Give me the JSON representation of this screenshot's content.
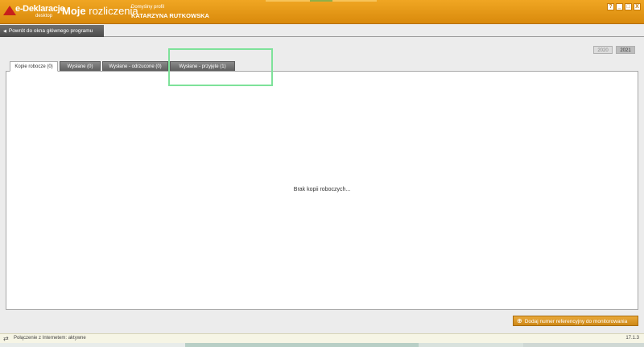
{
  "app": {
    "logo_name": "e-Deklaracje",
    "logo_sub": "desktop",
    "title_bold": "Moje",
    "title_rest": " rozliczenia",
    "profile_label": "Domyślny profil",
    "profile_name": "KATARZYNA RUTKOWSKA"
  },
  "window_buttons": [
    "?",
    "_",
    "□",
    "X"
  ],
  "back_button": {
    "label": "Powrót do okna głównego programu",
    "icon": "left-arrow-icon"
  },
  "years": [
    "2020",
    "2021"
  ],
  "tabs": [
    {
      "label": "Kopie robocze (0)",
      "active": true
    },
    {
      "label": "Wysłane (0)",
      "active": false
    },
    {
      "label": "Wysłane - odrzucone (0)",
      "active": false
    },
    {
      "label": "Wysłane - przyjęte (1)",
      "active": false
    }
  ],
  "content": {
    "empty_message": "Brak kopii roboczych..."
  },
  "footer": {
    "add_reference_label": "Dodaj numer referencyjny do monitorowania",
    "add_reference_icon": "add-document-icon"
  },
  "status": {
    "text": "Połączenie z Internetem: aktywne",
    "version": "17.1.3",
    "icon": "network-icon"
  },
  "colors": {
    "accent": "#e49a1c",
    "highlight": "#7ee29a",
    "tab_dark": "#6b6b6b"
  }
}
